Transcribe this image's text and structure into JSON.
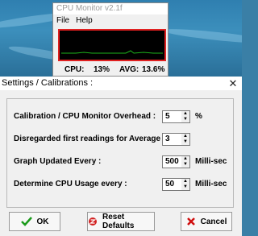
{
  "cpu_monitor": {
    "title": "CPU Monitor v2.1f",
    "menu": [
      {
        "label": "File"
      },
      {
        "label": "Help"
      }
    ],
    "cpu_label": "CPU:",
    "cpu_value": "13%",
    "avg_label": "AVG:",
    "avg_value": "13.6%",
    "graph_color": "#1db31d",
    "frame_color": "#e02020"
  },
  "dialog": {
    "title": "Settings / Calibrations :",
    "close_glyph": "✕",
    "rows": [
      {
        "label": "Calibration / CPU Monitor Overhead :",
        "value": "5",
        "unit": "%"
      },
      {
        "label": "Disregarded first readings for Average Calc :",
        "value": "3",
        "unit": ""
      },
      {
        "label": "Graph Updated Every :",
        "value": "500",
        "unit": "Milli-sec"
      },
      {
        "label": "Determine CPU Usage every :",
        "value": "50",
        "unit": "Milli-sec"
      }
    ],
    "buttons": {
      "ok": "OK",
      "reset": "Reset Defaults",
      "cancel": "Cancel"
    }
  },
  "icons": {
    "ok": "check-icon",
    "reset": "reset-icon",
    "cancel": "cancel-icon"
  }
}
